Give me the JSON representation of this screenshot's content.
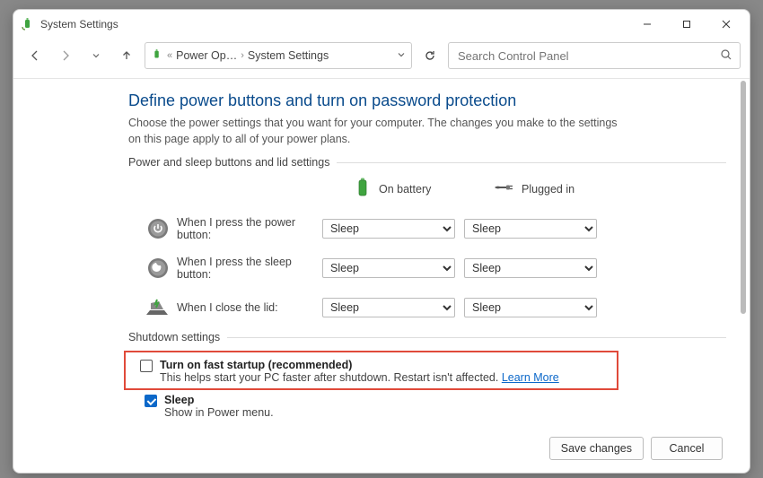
{
  "titlebar": {
    "title": "System Settings"
  },
  "address": {
    "crumb1": "Power Op…",
    "crumb2": "System Settings"
  },
  "search": {
    "placeholder": "Search Control Panel"
  },
  "page": {
    "title": "Define power buttons and turn on password protection",
    "description": "Choose the power settings that you want for your computer. The changes you make to the settings on this page apply to all of your power plans."
  },
  "section_buttons_label": "Power and sleep buttons and lid settings",
  "cols": {
    "battery": "On battery",
    "plugged": "Plugged in"
  },
  "rows": {
    "power": {
      "label": "When I press the power button:",
      "battery": "Sleep",
      "plugged": "Sleep"
    },
    "sleep": {
      "label": "When I press the sleep button:",
      "battery": "Sleep",
      "plugged": "Sleep"
    },
    "lid": {
      "label": "When I close the lid:",
      "battery": "Sleep",
      "plugged": "Sleep"
    }
  },
  "section_shutdown_label": "Shutdown settings",
  "shutdown": {
    "fast_startup": {
      "label": "Turn on fast startup (recommended)",
      "desc": "This helps start your PC faster after shutdown. Restart isn't affected. ",
      "link": "Learn More"
    },
    "sleep": {
      "label": "Sleep",
      "desc": "Show in Power menu."
    }
  },
  "buttons": {
    "save": "Save changes",
    "cancel": "Cancel"
  }
}
